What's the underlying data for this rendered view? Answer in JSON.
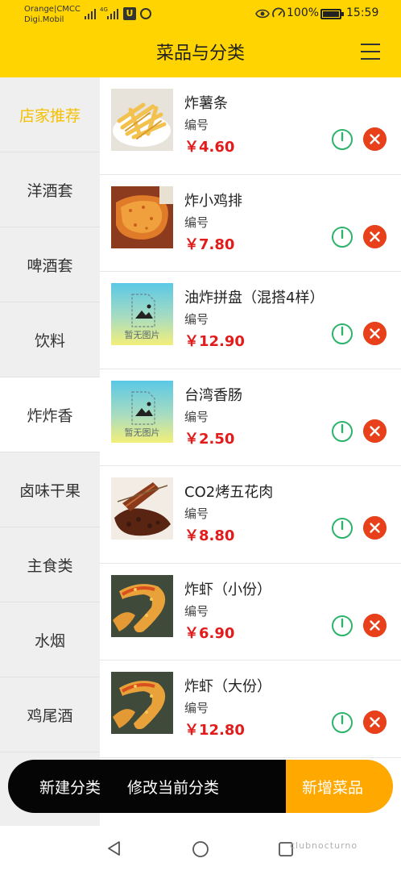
{
  "status_bar": {
    "carrier_line1": "Orange|CMCC",
    "carrier_line2": "Digi.Mobil",
    "network": "4G",
    "battery": "100%",
    "time": "15:59"
  },
  "header": {
    "title": "菜品与分类"
  },
  "sidebar": {
    "items": [
      {
        "label": "店家推荐"
      },
      {
        "label": "洋酒套"
      },
      {
        "label": "啤酒套"
      },
      {
        "label": "饮料"
      },
      {
        "label": "炸炸香"
      },
      {
        "label": "卤味干果"
      },
      {
        "label": "主食类"
      },
      {
        "label": "水烟"
      },
      {
        "label": "鸡尾酒"
      }
    ],
    "active_index": 4
  },
  "dishes": [
    {
      "name": "炸薯条",
      "code_label": "编号",
      "price": "￥4.60",
      "image": "fries-photo"
    },
    {
      "name": "炸小鸡排",
      "code_label": "编号",
      "price": "￥7.80",
      "image": "chicken-cutlet-photo"
    },
    {
      "name": "油炸拼盘（混搭4样）",
      "code_label": "编号",
      "price": "￥12.90",
      "image": "placeholder",
      "placeholder_text": "暂无图片"
    },
    {
      "name": "台湾香肠",
      "code_label": "编号",
      "price": "￥2.50",
      "image": "placeholder",
      "placeholder_text": "暂无图片"
    },
    {
      "name": "CO2烤五花肉",
      "code_label": "编号",
      "price": "￥8.80",
      "image": "pork-belly-photo"
    },
    {
      "name": "炸虾（小份）",
      "code_label": "编号",
      "price": "￥6.90",
      "image": "fried-shrimp-photo"
    },
    {
      "name": "炸虾（大份）",
      "code_label": "编号",
      "price": "￥12.80",
      "image": "fried-shrimp-photo"
    }
  ],
  "actions": {
    "new_category": "新建分类",
    "edit_category": "修改当前分类",
    "add_dish": "新增菜品"
  },
  "watermark": "clubnocturno",
  "colors": {
    "header": "#ffd400",
    "price": "#e21b1b",
    "power": "#2db36b",
    "delete": "#e8401a",
    "add_button": "#ffa800",
    "recommend_text": "#f5c000"
  }
}
